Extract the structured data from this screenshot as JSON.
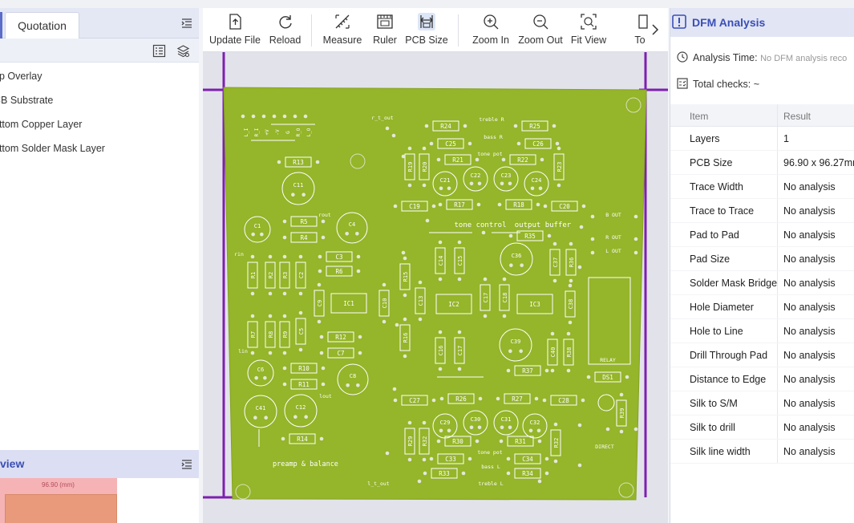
{
  "left": {
    "tab": "Quotation",
    "layers": [
      "op Overlay",
      "CB Substrate",
      "ottom Copper Layer",
      "ottom Solder Mask Layer"
    ],
    "preview_title": "view",
    "preview_dim": "96.90 (mm)"
  },
  "toolbar": {
    "buttons": [
      "Update File",
      "Reload",
      "Measure",
      "Ruler",
      "PCB Size",
      "Zoom In",
      "Zoom Out",
      "Fit View",
      "To"
    ]
  },
  "board": {
    "labels": {
      "title_left": "preamp & balance",
      "tone": "tone control",
      "output": "output buffer",
      "r_t_out": "r_t_out",
      "l_t_out": "l_t_out",
      "rin": "rin",
      "lin": "lin",
      "rout": "rout",
      "lout": "lout",
      "treble_r": "treble R",
      "bass_r": "bass R",
      "tone_pot": "tone pot",
      "bass_l": "bass L",
      "treble_l": "treble L",
      "relay": "RELAY",
      "direct": "DIRECT",
      "b_out": "B OUT",
      "r_out": "R OUT",
      "l_out": "L OUT"
    },
    "resistors": [
      "R24",
      "R25",
      "R21",
      "R22",
      "R19",
      "R20",
      "R23",
      "R17",
      "R18",
      "R13",
      "R5",
      "R4",
      "R6",
      "R12",
      "R10",
      "R11",
      "R14",
      "R35",
      "R37",
      "R26",
      "R27",
      "R30",
      "R31",
      "R33",
      "R34",
      "R28",
      "R29",
      "R32",
      "R36",
      "R38",
      "R39",
      "R1",
      "R2",
      "R3",
      "R7",
      "R8",
      "R9",
      "R15",
      "R16"
    ],
    "caps": [
      "C25",
      "C26",
      "C21",
      "C22",
      "C23",
      "C24",
      "C19",
      "C20",
      "C11",
      "C1",
      "C4",
      "C3",
      "C2",
      "C9",
      "C10",
      "C7",
      "C6",
      "C5",
      "C8",
      "C41",
      "C12",
      "C36",
      "C37",
      "C39",
      "C40",
      "C27",
      "C28",
      "C29",
      "C30",
      "C31",
      "C32",
      "C33",
      "C34",
      "C13",
      "C14",
      "C15",
      "C16",
      "C17",
      "C18",
      "C35",
      "C38"
    ],
    "ics": [
      "IC1",
      "IC2",
      "IC3"
    ],
    "ds": "DS1"
  },
  "dfm": {
    "title": "DFM Analysis",
    "analysis_time_label": "Analysis Time:",
    "analysis_time_value": "No DFM analysis reco",
    "total_checks_label": "Total checks:",
    "total_checks_value": "~",
    "col_item": "Item",
    "col_result": "Result",
    "rows": [
      {
        "item": "Layers",
        "result": "1"
      },
      {
        "item": "PCB Size",
        "result": "96.90 x 96.27mm"
      },
      {
        "item": "Trace Width",
        "result": "No analysis"
      },
      {
        "item": "Trace to Trace",
        "result": "No analysis"
      },
      {
        "item": "Pad to Pad",
        "result": "No analysis"
      },
      {
        "item": "Pad Size",
        "result": "No analysis"
      },
      {
        "item": "Solder Mask Bridge",
        "result": "No analysis"
      },
      {
        "item": "Hole Diameter",
        "result": "No analysis"
      },
      {
        "item": "Hole to Line",
        "result": "No analysis"
      },
      {
        "item": "Drill Through Pad",
        "result": "No analysis"
      },
      {
        "item": "Distance to Edge",
        "result": "No analysis"
      },
      {
        "item": "Silk to S/M",
        "result": "No analysis"
      },
      {
        "item": "Silk to drill",
        "result": "No analysis"
      },
      {
        "item": "Silk line width",
        "result": "No analysis"
      }
    ]
  },
  "colors": {
    "accent": "#3a4fb6",
    "board": "#95b52a",
    "frame": "#7e1fb0"
  }
}
